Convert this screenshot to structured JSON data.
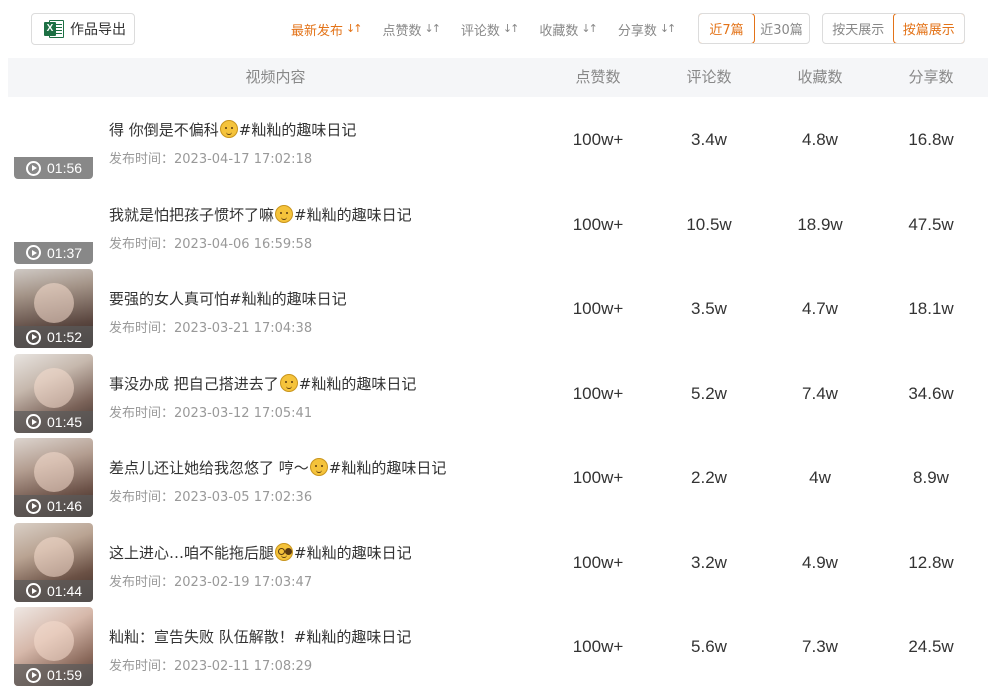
{
  "toolbar": {
    "export_label": "作品导出",
    "excel_badge": "X",
    "sorts": [
      {
        "label": "最新发布",
        "active": true
      },
      {
        "label": "点赞数",
        "active": false
      },
      {
        "label": "评论数",
        "active": false
      },
      {
        "label": "收藏数",
        "active": false
      },
      {
        "label": "分享数",
        "active": false
      }
    ],
    "range_options": [
      {
        "label": "近7篇",
        "active": true
      },
      {
        "label": "近30篇",
        "active": false
      }
    ],
    "mode_options": [
      {
        "label": "按天展示",
        "active": false
      },
      {
        "label": "按篇展示",
        "active": true
      }
    ],
    "accent_color": "#e37318"
  },
  "table": {
    "headers": {
      "content": "视频内容",
      "likes": "点赞数",
      "comments": "评论数",
      "favorites": "收藏数",
      "shares": "分享数"
    },
    "publish_label": "发布时间：",
    "rows": [
      {
        "title_pre": "得 你倒是不偏科",
        "emoji": "smile",
        "title_post": "#籼籼的趣味日记",
        "published": "2023-04-17 17:02:18",
        "duration": "01:56",
        "likes": "100w+",
        "comments": "3.4w",
        "favorites": "4.8w",
        "shares": "16.8w",
        "thumb": "blank"
      },
      {
        "title_pre": "我就是怕把孩子惯坏了嘛",
        "emoji": "smile",
        "title_post": "#籼籼的趣味日记",
        "published": "2023-04-06 16:59:58",
        "duration": "01:37",
        "likes": "100w+",
        "comments": "10.5w",
        "favorites": "18.9w",
        "shares": "47.5w",
        "thumb": "blank"
      },
      {
        "title_pre": "要强的女人真可怕",
        "emoji": "",
        "title_post": "#籼籼的趣味日记",
        "published": "2023-03-21 17:04:38",
        "duration": "01:52",
        "likes": "100w+",
        "comments": "3.5w",
        "favorites": "4.7w",
        "shares": "18.1w",
        "thumb": "photo"
      },
      {
        "title_pre": "事没办成 把自己搭进去了",
        "emoji": "smile",
        "title_post": "#籼籼的趣味日记",
        "published": "2023-03-12 17:05:41",
        "duration": "01:45",
        "likes": "100w+",
        "comments": "5.2w",
        "favorites": "7.4w",
        "shares": "34.6w",
        "thumb": "photo"
      },
      {
        "title_pre": "差点儿还让她给我忽悠了 哼～",
        "emoji": "smile",
        "title_post": "#籼籼的趣味日记",
        "published": "2023-03-05 17:02:36",
        "duration": "01:46",
        "likes": "100w+",
        "comments": "2.2w",
        "favorites": "4w",
        "shares": "8.9w",
        "thumb": "photo"
      },
      {
        "title_pre": "这上进心…咱不能拖后腿",
        "emoji": "glasses",
        "title_post": "#籼籼的趣味日记",
        "published": "2023-02-19 17:03:47",
        "duration": "01:44",
        "likes": "100w+",
        "comments": "3.2w",
        "favorites": "4.9w",
        "shares": "12.8w",
        "thumb": "photo"
      },
      {
        "title_pre": "籼籼：宣告失败 队伍解散！",
        "emoji": "",
        "title_post": "#籼籼的趣味日记",
        "published": "2023-02-11 17:08:29",
        "duration": "01:59",
        "likes": "100w+",
        "comments": "5.6w",
        "favorites": "7.3w",
        "shares": "24.5w",
        "thumb": "photo"
      }
    ]
  }
}
